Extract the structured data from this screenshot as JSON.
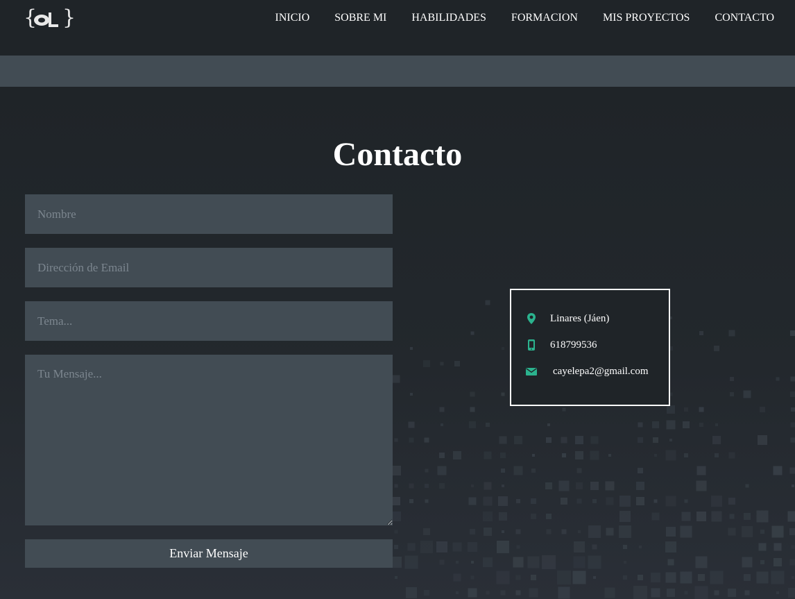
{
  "nav": {
    "items": [
      "INICIO",
      "SOBRE MI",
      "HABILIDADES",
      "FORMACION",
      "MIS PROYECTOS",
      "CONTACTO"
    ]
  },
  "contact": {
    "title": "Contacto",
    "form": {
      "name_placeholder": "Nombre",
      "email_placeholder": "Dirección de Email",
      "subject_placeholder": "Tema...",
      "message_placeholder": "Tu Mensaje...",
      "submit_label": "Enviar Mensaje"
    },
    "info": {
      "location": "Linares (Jáen)",
      "phone": "618799536",
      "email": "cayelepa2@gmail.com"
    }
  },
  "colors": {
    "background": "#1f2428",
    "panel": "#424c54",
    "accent": "#2bb38e",
    "text": "#ffffff",
    "placeholder": "#7c868f"
  },
  "icons": {
    "location": "map-marker-icon",
    "phone": "mobile-phone-icon",
    "email": "envelope-icon"
  }
}
